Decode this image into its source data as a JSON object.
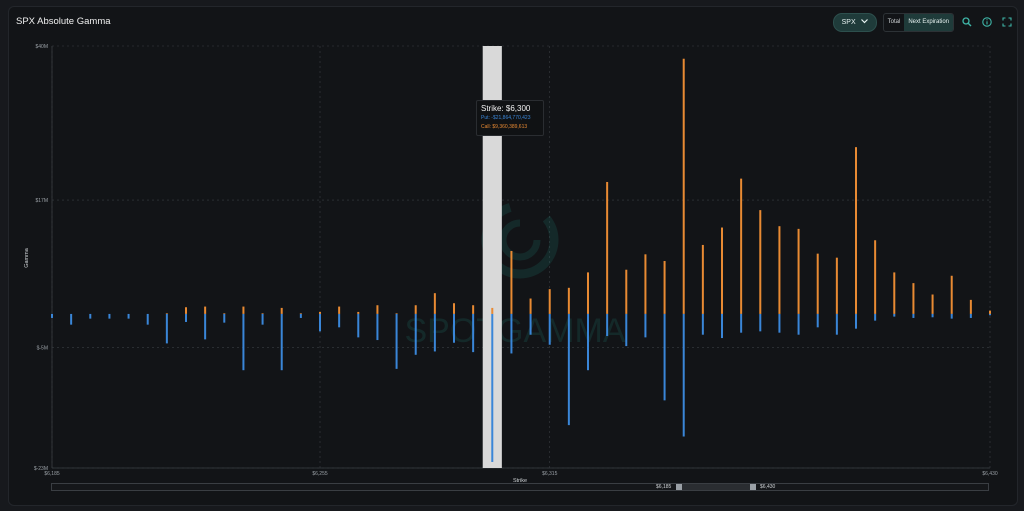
{
  "header": {
    "title": "SPX Absolute Gamma",
    "symbol": "SPX",
    "toggle": [
      "Total",
      "Next Expiration"
    ],
    "active_toggle": "Next Expiration",
    "icons": [
      "search-icon",
      "info-icon",
      "expand-icon"
    ]
  },
  "tooltip": {
    "title": "Strike: $6,300",
    "put": "Put: -$21,864,770,423",
    "call": "Call: $9,360,389,613"
  },
  "range": {
    "left_label": "$6,185",
    "right_label": "$6,430"
  },
  "watermark": "SPOTGAMMA",
  "colors": {
    "call": "#e88a33",
    "put": "#3a86d8",
    "accent": "#1f3b3a",
    "highlight": "#d9d9d9"
  },
  "chart_data": {
    "type": "bar",
    "title": "SPX Absolute Gamma",
    "xlabel": "Strike",
    "ylabel": "Gamma",
    "ylim": [
      -23,
      40
    ],
    "y_tick_labels": [
      "$40M",
      "$17M",
      "$-5M",
      "$-23M"
    ],
    "y_tick_values": [
      40,
      17,
      -5,
      -23
    ],
    "x_tick_labels": [
      "$6,185",
      "$6,255",
      "$6,315",
      "$6,430"
    ],
    "x_tick_values": [
      6185,
      6255,
      6315,
      6430
    ],
    "categories": [
      6185,
      6190,
      6195,
      6200,
      6205,
      6210,
      6215,
      6220,
      6225,
      6230,
      6235,
      6240,
      6245,
      6250,
      6255,
      6260,
      6265,
      6270,
      6275,
      6280,
      6285,
      6290,
      6295,
      6300,
      6305,
      6310,
      6315,
      6320,
      6325,
      6330,
      6335,
      6340,
      6345,
      6350,
      6355,
      6360,
      6365,
      6370,
      6375,
      6380,
      6385,
      6390,
      6395,
      6400,
      6405,
      6410,
      6415,
      6420,
      6425,
      6430
    ],
    "series": [
      {
        "name": "Call",
        "values": [
          0.0,
          0.0,
          0.0,
          0.0,
          0.0,
          0.0,
          0.1,
          1.0,
          1.1,
          0.1,
          1.1,
          0.1,
          0.9,
          0.1,
          0.3,
          1.1,
          0.3,
          1.3,
          0.1,
          1.3,
          3.1,
          1.6,
          1.3,
          0.9,
          9.4,
          2.3,
          3.7,
          3.9,
          6.2,
          19.7,
          6.6,
          8.9,
          7.9,
          38.1,
          10.3,
          12.9,
          20.2,
          15.5,
          13.1,
          12.7,
          9.0,
          8.4,
          24.9,
          11.0,
          6.2,
          4.6,
          2.9,
          5.7,
          2.1,
          0.5
        ]
      },
      {
        "name": "Put",
        "values": [
          -0.6,
          -1.6,
          -0.7,
          -0.7,
          -0.7,
          -1.6,
          -4.4,
          -1.2,
          -3.8,
          -1.3,
          -8.4,
          -1.6,
          -8.4,
          -0.6,
          -2.6,
          -2.0,
          -3.5,
          -3.9,
          -8.2,
          -6.1,
          -5.6,
          -4.3,
          -5.7,
          -22.1,
          -5.9,
          -3.1,
          -4.6,
          -16.6,
          -8.4,
          -3.3,
          -4.8,
          -3.5,
          -12.9,
          -18.3,
          -3.1,
          -3.6,
          -2.8,
          -2.6,
          -2.8,
          -3.1,
          -2.0,
          -3.1,
          -2.2,
          -1.0,
          -0.4,
          -0.6,
          -0.5,
          -0.7,
          -0.6,
          -0.2
        ]
      }
    ],
    "highlight_category": 6300,
    "grid": true
  }
}
